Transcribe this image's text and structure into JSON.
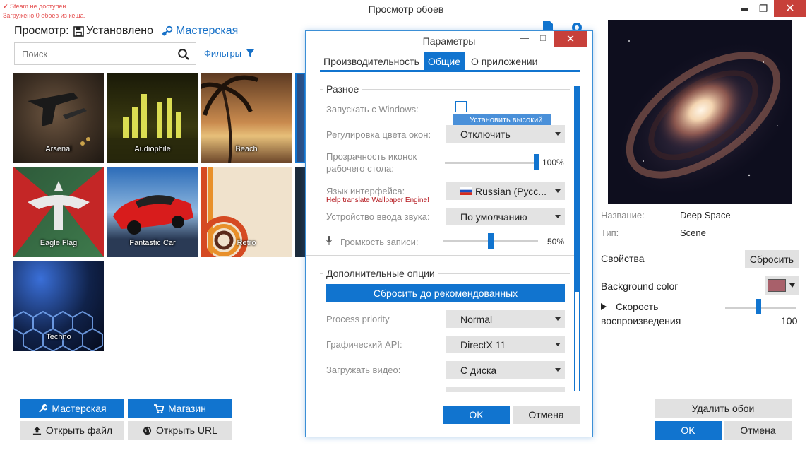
{
  "window": {
    "title": "Просмотр обоев",
    "minimize": "▬",
    "restore": "❐",
    "close": "✕"
  },
  "status": {
    "steam_unavailable": "✔ Steam не доступен.",
    "cache_loaded": "Загружено 0 обоев из кеша."
  },
  "browser": {
    "view_label": "Просмотр:",
    "installed_tab": "Установлено",
    "workshop_tab": "Мастерская",
    "search_placeholder": "Поиск",
    "filters_label": "Фильтры",
    "tiles": [
      {
        "label": "Arsenal"
      },
      {
        "label": "Audiophile"
      },
      {
        "label": "Beach"
      },
      {
        "label": "Eagle Flag"
      },
      {
        "label": "Fantastic Car"
      },
      {
        "label": "Retro"
      },
      {
        "label": "Techno"
      }
    ],
    "workshop_button": "Мастерская",
    "store_button": "Магазин",
    "open_file_button": "Открыть файл",
    "open_url_button": "Открыть URL"
  },
  "dialog": {
    "title": "Параметры",
    "minimize": "—",
    "restore": "□",
    "close": "✕",
    "tabs": [
      "Производительность",
      "Общие",
      "О приложении"
    ],
    "active_tab": "Общие",
    "misc_group": "Разное",
    "start_with_windows_label": "Запускать с Windows:",
    "start_with_windows_checked": false,
    "tooltip_text": "Установить высокий",
    "window_color_label": "Регулировка цвета окон:",
    "window_color_value": "Отключить",
    "icon_transparency_label_1": "Прозрачность иконок",
    "icon_transparency_label_2": "рабочего стола:",
    "icon_transparency_value": "100%",
    "icon_transparency_level": 1.0,
    "language_label": "Язык интерфейса:",
    "language_value": "Russian (Русс...",
    "translate_link": "Help translate Wallpaper Engine!",
    "audio_device_label": "Устройство ввода звука:",
    "audio_device_value": "По умолчанию",
    "record_volume_label": "Громкость записи:",
    "record_volume_value": "50%",
    "record_volume_level": 0.5,
    "advanced_group": "Дополнительные опции",
    "reset_button": "Сбросить до рекомендованных",
    "process_priority_label": "Process priority",
    "process_priority_value": "Normal",
    "graphics_api_label": "Графический API:",
    "graphics_api_value": "DirectX 11",
    "load_video_label": "Загружать видео:",
    "load_video_value": "С диска",
    "ok_button": "OK",
    "cancel_button": "Отмена"
  },
  "details": {
    "name_label": "Название:",
    "name_value": "Deep Space",
    "type_label": "Тип:",
    "type_value": "Scene",
    "properties_label": "Свойства",
    "reset_button": "Сбросить",
    "background_color_label": "Background color",
    "background_color": "#a8606a",
    "playback_speed_label_1": "Скорость",
    "playback_speed_label_2": "воспроизведения",
    "playback_speed_value": "100",
    "playback_speed_level": 0.47,
    "delete_button": "Удалить обои",
    "ok_button": "OK",
    "cancel_button": "Отмена"
  },
  "colors": {
    "accent": "#1174cf",
    "close_red": "#c7403a",
    "link_blue": "#1670c7"
  }
}
